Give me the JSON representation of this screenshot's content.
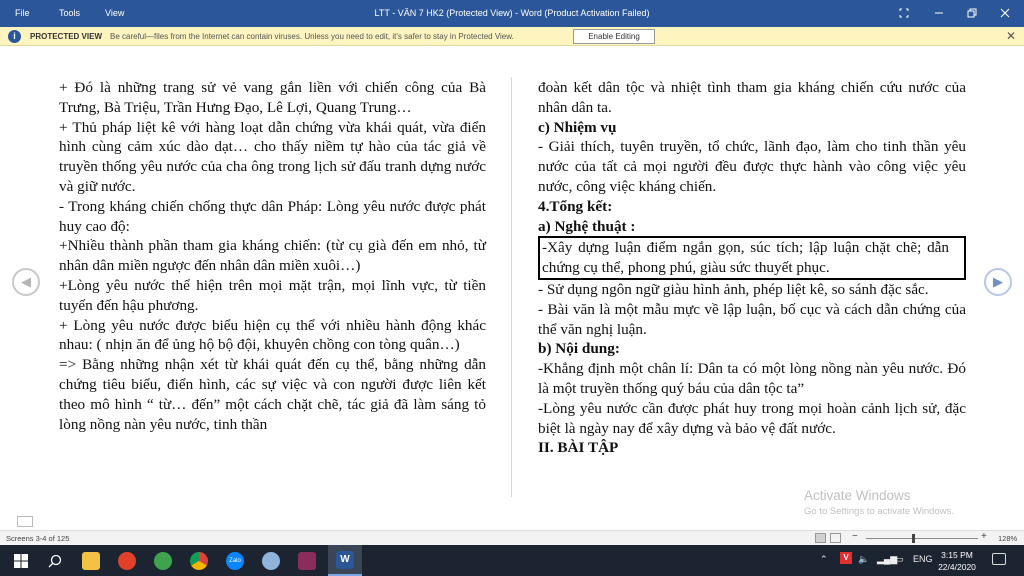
{
  "titlebar": {
    "menu": [
      "File",
      "Tools",
      "View"
    ],
    "title": "LTT - VĂN 7 HK2 (Protected View) - Word (Product Activation Failed)"
  },
  "protected_view": {
    "label": "PROTECTED VIEW",
    "message": "Be careful—files from the Internet can contain viruses. Unless you need to edit, it's safer to stay in Protected View.",
    "button": "Enable Editing"
  },
  "document": {
    "left": [
      "+ Đó là những trang sử vẻ vang gắn liền với chiến công của Bà Trưng, Bà Triệu, Trần Hưng Đạo, Lê Lợi, Quang Trung…",
      "+ Thủ pháp liệt kê với hàng loạt dẫn chứng vừa khái quát, vừa điển hình cùng cảm xúc dào dạt… cho thấy niềm tự hào của tác giả về truyền thống yêu nước của cha ông trong lịch sử đấu tranh dựng nước và giữ nước.",
      "- Trong kháng chiến chống thực dân Pháp: Lòng yêu nước được phát huy cao độ:",
      "+Nhiều thành phần tham gia kháng chiến: (từ cụ già đến em nhỏ, từ nhân dân miền ngược đến nhân dân miền xuôi…)",
      "+Lòng yêu nước thể hiện trên mọi mặt trận, mọi lĩnh vực, từ tiền tuyến đến hậu phương.",
      "+ Lòng yêu nước được biểu hiện cụ thể với nhiều hành động khác nhau: ( nhịn ăn để ủng hộ bộ đội, khuyên chồng con tòng quân…)",
      "=> Bằng những nhận xét từ khái quát đến cụ thể, bằng những dẫn chứng tiêu biểu, điển hình, các sự việc và con người được liên kết theo mô hình “ từ… đến” một cách chặt chẽ, tác giả đã làm sáng tỏ lòng nồng nàn yêu nước, tinh thần"
    ],
    "right_intro": "đoàn kết dân tộc và nhiệt tình tham gia kháng chiến cứu nước của nhân dân ta.",
    "heading_task": "c) Nhiệm vụ",
    "task_text": "- Giải thích, tuyên truyền, tổ chức, lãnh đạo, làm cho tinh thần yêu nước của tất cả mọi người đều được thực hành vào công việc yêu nước, công việc kháng chiến.",
    "heading_summary": "4.Tổng kết:",
    "heading_art": "a) Nghệ thuật :",
    "boxed_text": "-Xây dựng luận điểm ngắn gọn, súc tích; lập luận chặt chẽ; dẫn chứng cụ thể, phong phú, giàu sức thuyết phục.",
    "art_2": "- Sử dụng ngôn ngữ giàu hình ảnh, phép liệt kê, so sánh đặc sắc.",
    "art_3": "-  Bài văn là một mẫu mực về lập luận, bố cục và cách dẫn chứng của thể văn nghị luận.",
    "heading_content": "b) Nội dung:",
    "content_1": "-Khẳng định một chân lí: Dân ta có một lòng nồng nàn yêu nước. Đó là một truyền thống quý báu của dân tộc ta”",
    "content_2": "-Lòng yêu nước cần được phát huy trong mọi hoàn cảnh lịch sử, đặc biệt là ngày nay để xây dựng và bảo vệ đất nước.",
    "heading_exercise": "II. BÀI TẬP"
  },
  "watermark": {
    "line1": "Activate Windows",
    "line2": "Go to Settings to activate Windows."
  },
  "statusbar": {
    "screens": "Screens 3-4 of 125",
    "zoom": "128%"
  },
  "taskbar": {
    "language": "ENG",
    "time": "3:15 PM",
    "date": "22/4/2020"
  }
}
